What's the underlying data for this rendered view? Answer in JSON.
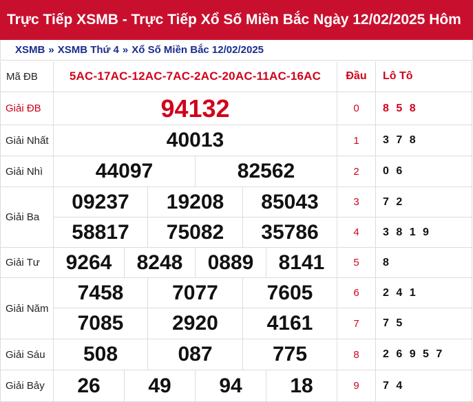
{
  "header": {
    "title": "Trực Tiếp XSMB - Trực Tiếp Xổ Số Miền Bắc Ngày 12/02/2025 Hôm"
  },
  "breadcrumb": {
    "items": [
      "XSMB",
      "XSMB Thứ 4",
      "Xổ Số Miền Bắc 12/02/2025"
    ],
    "separator": "»"
  },
  "table": {
    "madb_label": "Mã ĐB",
    "madb_value": "5AC-17AC-12AC-7AC-2AC-20AC-11AC-16AC",
    "dau_header": "Đầu",
    "loto_header": "Lô Tô",
    "prizes": [
      {
        "label": "Giải ĐB",
        "numbers": [
          "94132"
        ]
      },
      {
        "label": "Giải Nhất",
        "numbers": [
          "40013"
        ]
      },
      {
        "label": "Giải Nhì",
        "numbers": [
          "44097",
          "82562"
        ]
      },
      {
        "label": "Giải Ba",
        "numbers": [
          "09237",
          "19208",
          "85043",
          "58817",
          "75082",
          "35786"
        ]
      },
      {
        "label": "Giải Tư",
        "numbers": [
          "9264",
          "8248",
          "0889",
          "8141"
        ]
      },
      {
        "label": "Giải Năm",
        "numbers": [
          "7458",
          "7077",
          "7605",
          "7085",
          "2920",
          "4161"
        ]
      },
      {
        "label": "Giải Sáu",
        "numbers": [
          "508",
          "087",
          "775"
        ]
      },
      {
        "label": "Giải Bảy",
        "numbers": [
          "26",
          "49",
          "94",
          "18"
        ]
      }
    ],
    "loto": [
      {
        "dau": "0",
        "values": "8 5 8"
      },
      {
        "dau": "1",
        "values": "3 7 8"
      },
      {
        "dau": "2",
        "values": "0 6"
      },
      {
        "dau": "3",
        "values": "7 2"
      },
      {
        "dau": "4",
        "values": "3 8 1 9"
      },
      {
        "dau": "5",
        "values": "8"
      },
      {
        "dau": "6",
        "values": "2 4 1"
      },
      {
        "dau": "7",
        "values": "7 5"
      },
      {
        "dau": "8",
        "values": "2 6 9 5 7"
      },
      {
        "dau": "9",
        "values": "7 4"
      }
    ]
  },
  "colors": {
    "brand_red": "#c8102e",
    "accent_red": "#d0021b",
    "link_blue": "#1a2c8e"
  }
}
